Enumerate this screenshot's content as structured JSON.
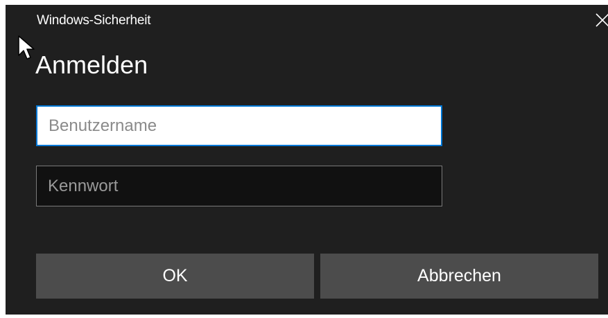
{
  "window": {
    "title": "Windows-Sicherheit",
    "close_icon": "close-icon"
  },
  "dialog": {
    "heading": "Anmelden"
  },
  "fields": {
    "username_placeholder": "Benutzername",
    "username_value": "",
    "password_placeholder": "Kennwort",
    "password_value": ""
  },
  "buttons": {
    "ok_label": "OK",
    "cancel_label": "Abbrechen"
  },
  "colors": {
    "dialog_background": "#1f1f1f",
    "focus_border": "#0078d7",
    "button_background": "#4c4c4c",
    "text": "#ffffff"
  }
}
